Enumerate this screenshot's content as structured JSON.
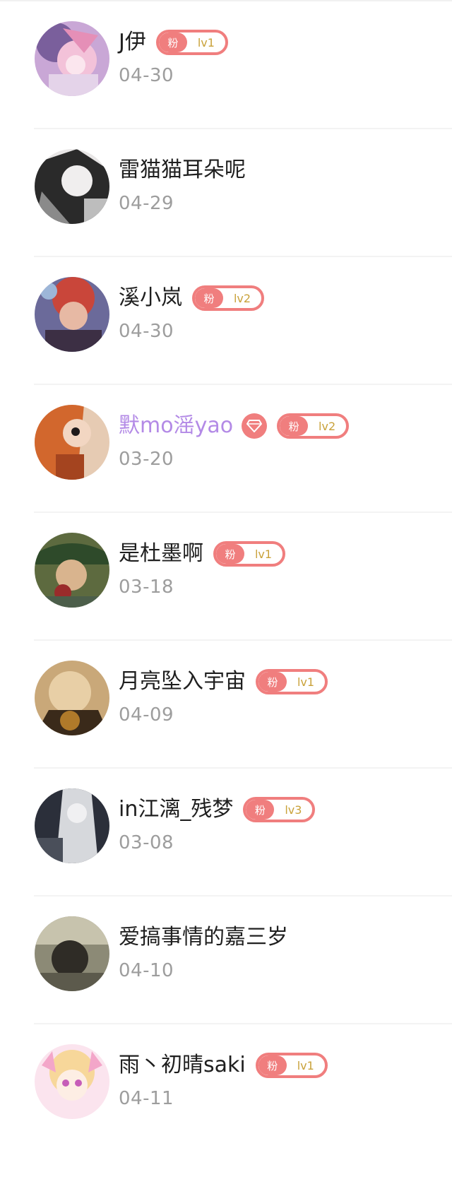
{
  "badge_fan_label": "粉",
  "users": [
    {
      "name": "J伊",
      "date": "04-30",
      "badge_level": "lv1",
      "has_badge": true
    },
    {
      "name": "雷猫猫耳朵呢",
      "date": "04-29",
      "has_badge": false
    },
    {
      "name": "溪小岚",
      "date": "04-30",
      "badge_level": "lv2",
      "has_badge": true
    },
    {
      "name": "默mo滛yao",
      "date": "03-20",
      "badge_level": "lv2",
      "has_badge": true,
      "vip": true
    },
    {
      "name": "是杜墨啊",
      "date": "03-18",
      "badge_level": "lv1",
      "has_badge": true
    },
    {
      "name": "月亮坠入宇宙",
      "date": "04-09",
      "badge_level": "lv1",
      "has_badge": true
    },
    {
      "name": "in江漓_残梦",
      "date": "03-08",
      "badge_level": "lv3",
      "has_badge": true
    },
    {
      "name": "爱搞事情的嘉三岁",
      "date": "04-10",
      "has_badge": false
    },
    {
      "name": "雨丶初晴saki",
      "date": "04-11",
      "badge_level": "lv1",
      "has_badge": true
    }
  ],
  "colors": {
    "badge": "#f07e7e",
    "badge_level_text": "#c9a23a",
    "vip_name": "#b38ae6",
    "date_text": "#9d9d9d"
  }
}
